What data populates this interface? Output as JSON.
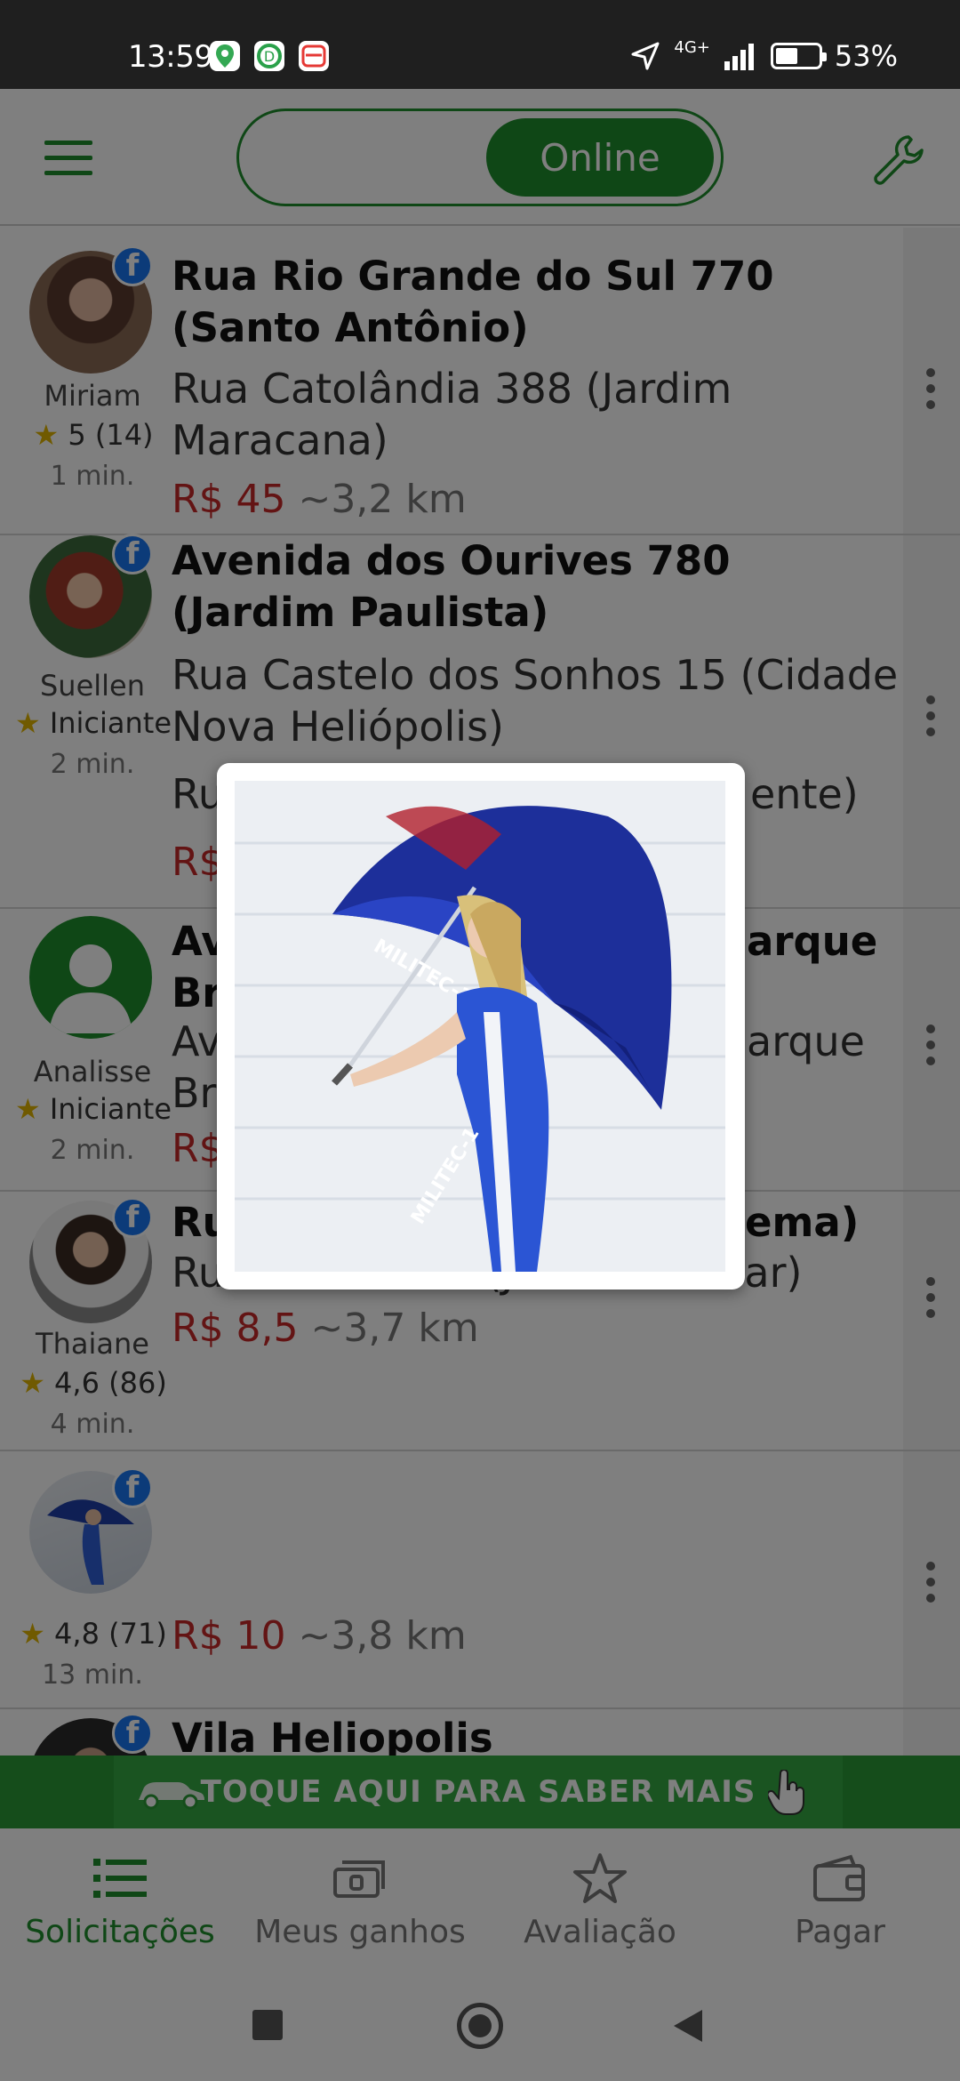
{
  "status_bar": {
    "time": "13:59",
    "network": "4G+",
    "battery": "53%",
    "battery_level": 0.53
  },
  "app_bar": {
    "toggle_label": "Online"
  },
  "requests": [
    {
      "name": "Miriam",
      "rating": "5 (14)",
      "elapsed": "1 min.",
      "origin": "Rua Rio Grande do Sul 770 (Santo Antônio)",
      "destination": "Rua Catolândia 388 (Jardim Maracana)",
      "price": "R$ 45",
      "distance": "~3,2 km"
    },
    {
      "name": "Suellen",
      "rating": "Iniciante",
      "elapsed": "2 min.",
      "origin": "Avenida dos Ourives 780 (Jardim Paulista)",
      "destination": "Rua Castelo dos Sonhos 15 (Cidade Nova Heliópolis)",
      "destination2_start": "Ru",
      "destination2_end": "ente)",
      "price_fragment": "R$"
    },
    {
      "name": "Analisse",
      "rating": "Iniciante",
      "elapsed": "2 min.",
      "origin_start": "Av",
      "origin_end": "arque",
      "origin_line2": "Br",
      "destination_start": "Av",
      "destination_end": "arque",
      "destination_line2": "Br",
      "price_fragment": "R$"
    },
    {
      "name": "Thaiane",
      "rating": "4,6 (86)",
      "elapsed": "4 min.",
      "origin_start": "Ru",
      "origin_end": "ema)",
      "destination": "Rua Ártico 115 (Jardim do Mar)",
      "price": "R$ 8,5",
      "distance": "~3,7 km"
    },
    {
      "name": "",
      "rating": "4,8 (71)",
      "elapsed": "13 min.",
      "price": "R$ 10",
      "distance": "~3,8 km"
    },
    {
      "origin": "Vila Heliopolis"
    }
  ],
  "banner": {
    "text": "TOQUE AQUI PARA SABER MAIS"
  },
  "bottom_nav": [
    {
      "label": "Solicitações",
      "icon": "list-icon",
      "active": true
    },
    {
      "label": "Meus ganhos",
      "icon": "money-icon",
      "active": false
    },
    {
      "label": "Avaliação",
      "icon": "star-icon",
      "active": false
    },
    {
      "label": "Pagar",
      "icon": "wallet-icon",
      "active": false
    }
  ],
  "photo_dialog": {
    "umbrella_text": "MILITEC-1",
    "suit_text": "MILITEC-1"
  },
  "colors": {
    "brand_green": "#1f8e2c",
    "price_red": "#c62828",
    "facebook_blue": "#1877f2"
  }
}
